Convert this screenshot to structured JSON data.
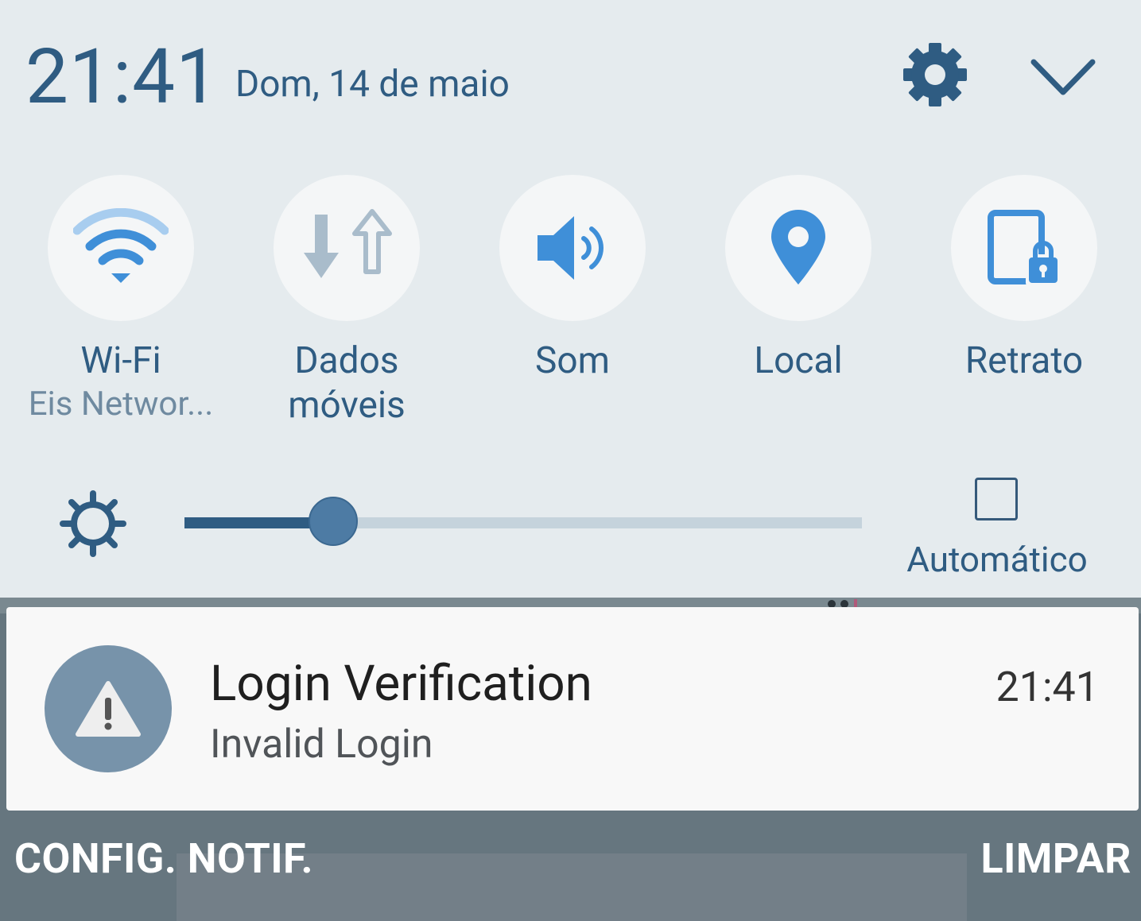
{
  "header": {
    "time": "21:41",
    "date": "Dom, 14 de maio",
    "settings_icon": "gear-icon",
    "expand_icon": "chevron-down-icon"
  },
  "quick_settings": [
    {
      "id": "wifi",
      "label": "Wi-Fi",
      "sub": "Eis Networ...",
      "icon": "wifi-icon",
      "active": true
    },
    {
      "id": "dados",
      "label": "Dados\nmóveis",
      "sub": "",
      "icon": "mobile-data-icon",
      "active": false
    },
    {
      "id": "som",
      "label": "Som",
      "sub": "",
      "icon": "volume-icon",
      "active": true
    },
    {
      "id": "local",
      "label": "Local",
      "sub": "",
      "icon": "location-pin-icon",
      "active": true
    },
    {
      "id": "retrato",
      "label": "Retrato",
      "sub": "",
      "icon": "portrait-lock-icon",
      "active": true
    }
  ],
  "brightness": {
    "level": 0.22,
    "auto_label": "Automático",
    "auto_checked": false
  },
  "notification": {
    "title": "Login Verification",
    "body": "Invalid Login",
    "time": "21:41",
    "icon": "warning-icon"
  },
  "footer": {
    "left": "CONFIG. NOTIF.",
    "right": "LIMPAR"
  },
  "colors": {
    "panel_bg": "#e5ebee",
    "text_blue": "#2f5c82",
    "accent_blue": "#3f8fd8",
    "inactive": "#a9bccb",
    "avatar_bg": "#7793aa"
  }
}
